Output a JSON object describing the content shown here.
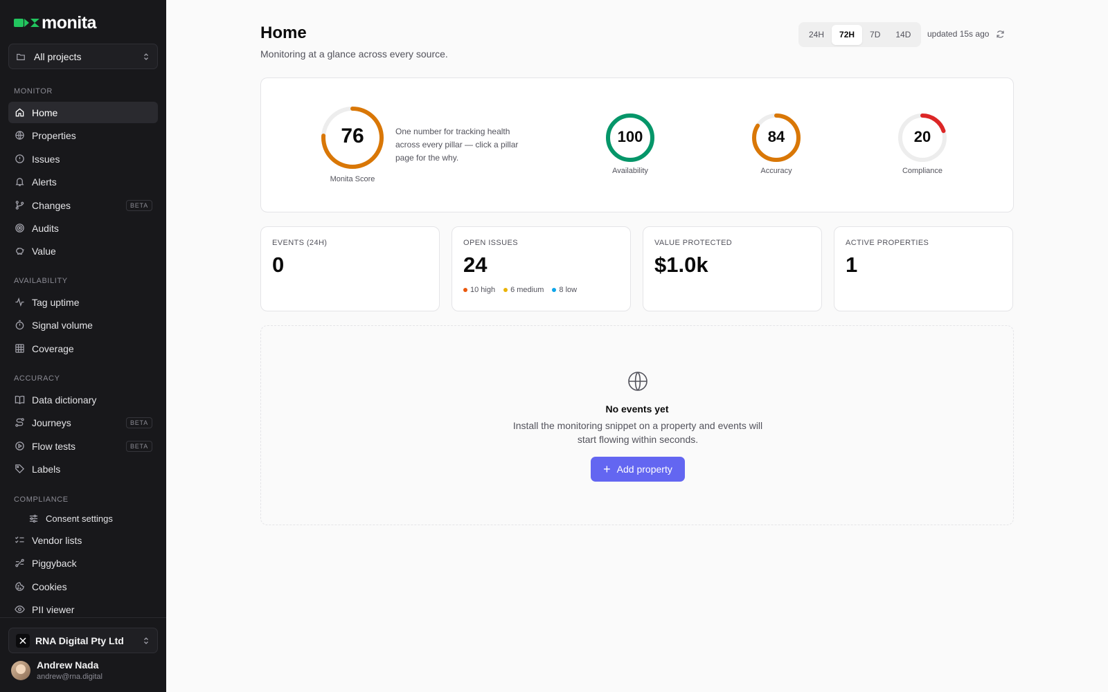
{
  "app": {
    "logo_text": "monita",
    "brand_color": "#22c55e",
    "accent_color": "#6366f1"
  },
  "sidebar": {
    "project_selector": "All projects",
    "sections": {
      "monitor": "MONITOR",
      "availability": "AVAILABILITY",
      "accuracy": "ACCURACY",
      "compliance": "COMPLIANCE"
    },
    "items": [
      {
        "label": "Home",
        "icon": "home-icon",
        "active": true
      },
      {
        "label": "Properties",
        "icon": "globe-icon"
      },
      {
        "label": "Issues",
        "icon": "alert-circle-icon"
      },
      {
        "label": "Alerts",
        "icon": "bell-icon"
      },
      {
        "label": "Changes",
        "icon": "git-branch-icon",
        "badge": "BETA"
      },
      {
        "label": "Audits",
        "icon": "target-icon"
      },
      {
        "label": "Value",
        "icon": "piggy-bank-icon"
      },
      {
        "label": "Tag uptime",
        "icon": "activity-icon"
      },
      {
        "label": "Signal volume",
        "icon": "timer-icon"
      },
      {
        "label": "Coverage",
        "icon": "grid-icon"
      },
      {
        "label": "Data dictionary",
        "icon": "book-icon"
      },
      {
        "label": "Journeys",
        "icon": "route-icon",
        "badge": "BETA"
      },
      {
        "label": "Flow tests",
        "icon": "play-circle-icon",
        "badge": "BETA"
      },
      {
        "label": "Labels",
        "icon": "tag-icon"
      },
      {
        "label": "Consent settings",
        "icon": "sliders-icon"
      },
      {
        "label": "Vendor lists",
        "icon": "list-checks-icon"
      },
      {
        "label": "Piggyback",
        "icon": "link-chain-icon"
      },
      {
        "label": "Cookies",
        "icon": "cookie-icon"
      },
      {
        "label": "PII viewer",
        "icon": "eye-icon"
      }
    ],
    "org": "RNA Digital Pty Ltd",
    "user": {
      "name": "Andrew Nada",
      "email": "andrew@rna.digital"
    }
  },
  "header": {
    "title": "Home",
    "subtitle": "Monitoring at a glance across every source.",
    "ranges": [
      "24H",
      "72H",
      "7D",
      "14D"
    ],
    "selected_range": "72H",
    "updated": "updated 15s ago"
  },
  "score": {
    "main": {
      "value": "76",
      "label": "Monita Score",
      "fraction": 0.76,
      "color": "#d97706"
    },
    "description": "One number for tracking health across every pillar — click a pillar page for the why.",
    "pillars": [
      {
        "value": "100",
        "label": "Availability",
        "fraction": 1.0,
        "color": "#059669"
      },
      {
        "value": "84",
        "label": "Accuracy",
        "fraction": 0.84,
        "color": "#d97706"
      },
      {
        "value": "20",
        "label": "Compliance",
        "fraction": 0.2,
        "color": "#dc2626"
      }
    ]
  },
  "stats": {
    "events": {
      "label": "EVENTS (24H)",
      "value": "0"
    },
    "issues": {
      "label": "OPEN ISSUES",
      "value": "24",
      "levels": [
        {
          "label": "10 high",
          "color": "#ea580c"
        },
        {
          "label": "6 medium",
          "color": "#eab308"
        },
        {
          "label": "8 low",
          "color": "#0ea5e9"
        }
      ]
    },
    "value_protected": {
      "label": "VALUE PROTECTED",
      "value": "$1.0k"
    },
    "active_properties": {
      "label": "ACTIVE PROPERTIES",
      "value": "1"
    }
  },
  "empty_state": {
    "icon": "globe-icon",
    "title": "No events yet",
    "description": "Install the monitoring snippet on a property and events will start flowing within seconds.",
    "button": "Add property"
  }
}
